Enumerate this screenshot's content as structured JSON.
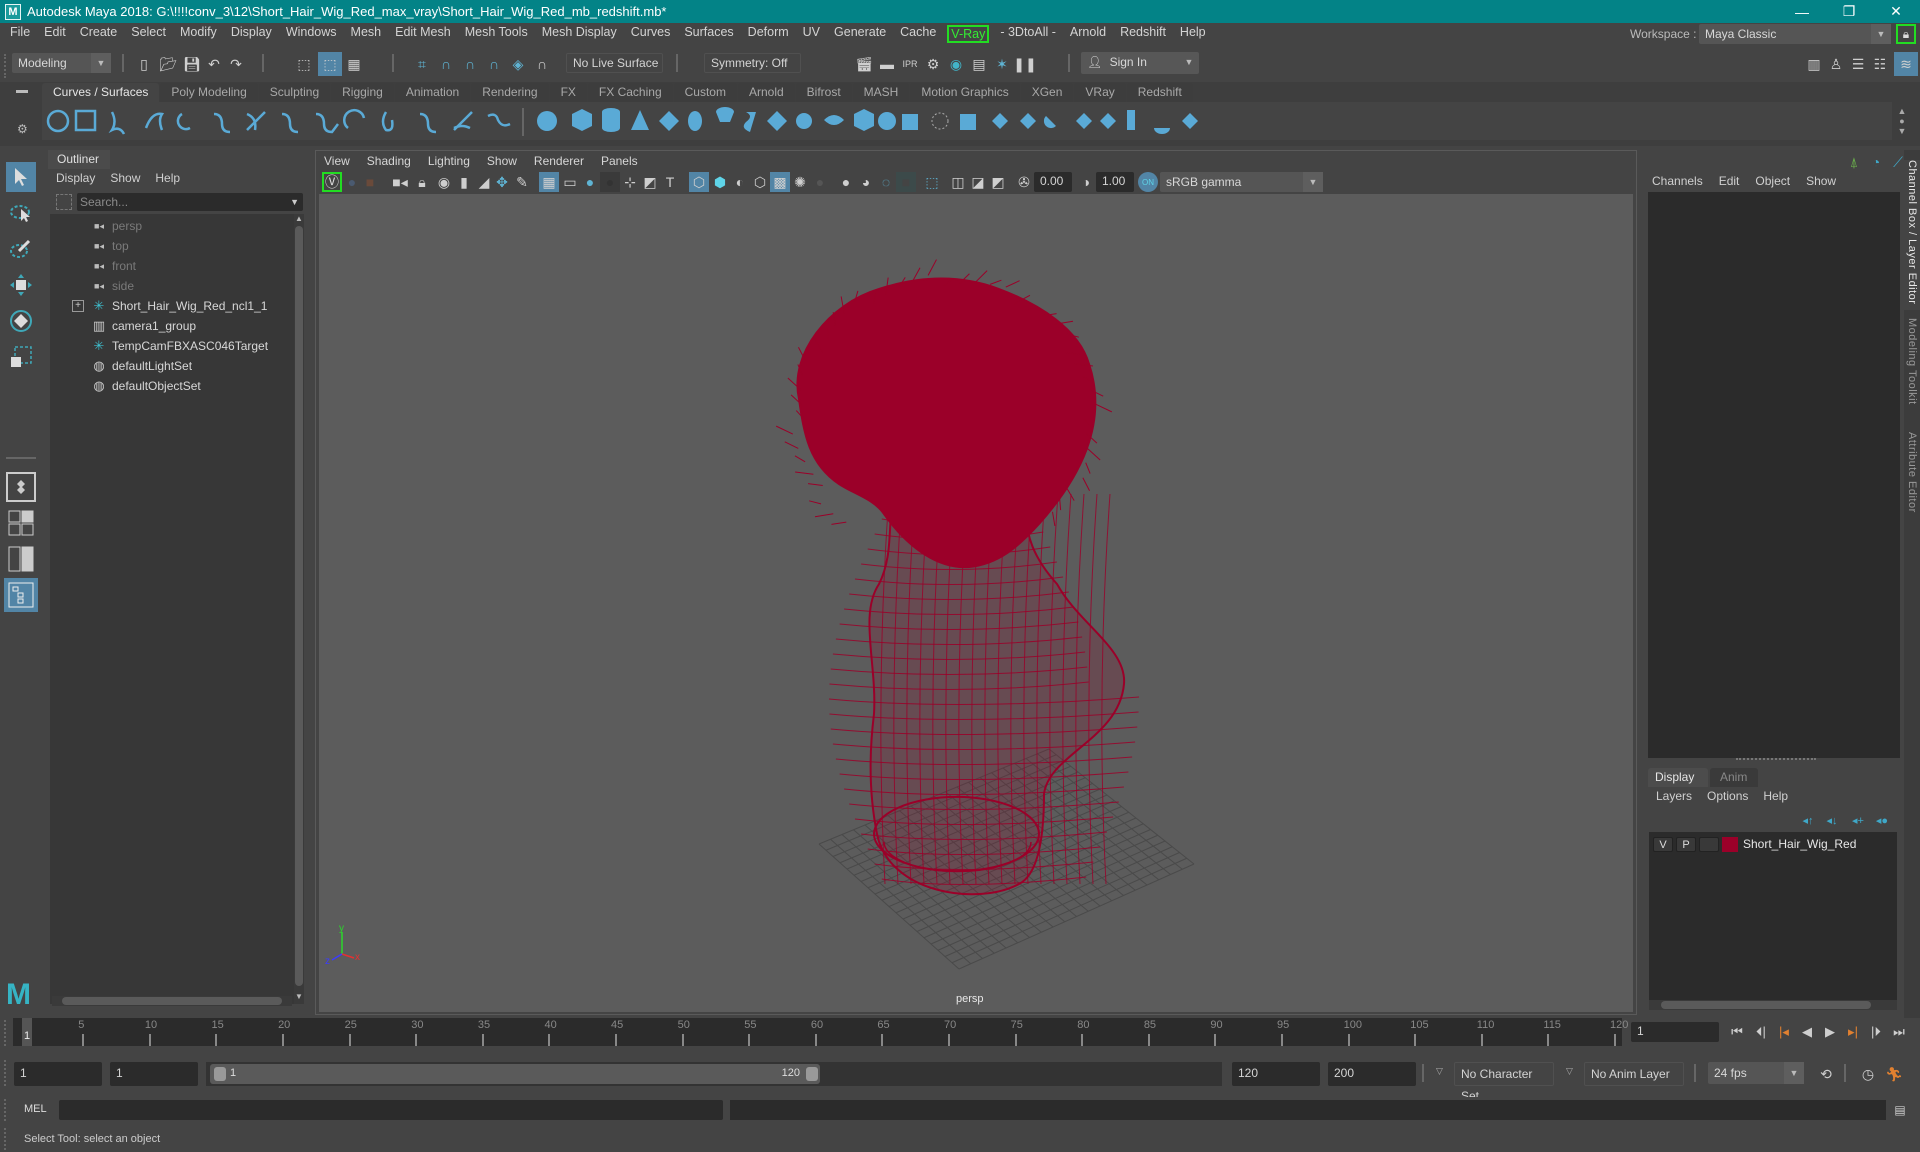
{
  "window": {
    "title": "Autodesk Maya 2018: G:\\!!!!conv_3\\12\\Short_Hair_Wig_Red_max_vray\\Short_Hair_Wig_Red_mb_redshift.mb*",
    "logo_letter": "M",
    "controls": {
      "minimize": "—",
      "maximize": "❐",
      "close": "✕"
    }
  },
  "menubar": {
    "items": [
      "File",
      "Edit",
      "Create",
      "Select",
      "Modify",
      "Display",
      "Windows",
      "Mesh",
      "Edit Mesh",
      "Mesh Tools",
      "Mesh Display",
      "Curves",
      "Surfaces",
      "Deform",
      "UV",
      "Generate",
      "Cache",
      "V-Ray",
      "- 3DtoAll -",
      "Arnold",
      "Redshift",
      "Help"
    ],
    "workspace_label": "Workspace :",
    "workspace_value": "Maya Classic"
  },
  "statusline": {
    "mode": "Modeling",
    "live_surface": "No Live Surface",
    "symmetry": "Symmetry: Off",
    "sign_in": "Sign In"
  },
  "shelf": {
    "tabs": [
      "Curves / Surfaces",
      "Poly Modeling",
      "Sculpting",
      "Rigging",
      "Animation",
      "Rendering",
      "FX",
      "FX Caching",
      "Custom",
      "Arnold",
      "Bifrost",
      "MASH",
      "Motion Graphics",
      "XGen",
      "VRay",
      "Redshift"
    ],
    "active_tab": "Curves / Surfaces"
  },
  "outliner": {
    "tab": "Outliner",
    "menu": [
      "Display",
      "Show",
      "Help"
    ],
    "search_placeholder": "Search...",
    "items": [
      {
        "name": "persp",
        "icon": "camera-icon",
        "dim": true,
        "expandable": false
      },
      {
        "name": "top",
        "icon": "camera-icon",
        "dim": true,
        "expandable": false
      },
      {
        "name": "front",
        "icon": "camera-icon",
        "dim": true,
        "expandable": false
      },
      {
        "name": "side",
        "icon": "camera-icon",
        "dim": true,
        "expandable": false
      },
      {
        "name": "Short_Hair_Wig_Red_ncl1_1",
        "icon": "locator-icon",
        "dim": false,
        "expandable": true
      },
      {
        "name": "camera1_group",
        "icon": "group-icon",
        "dim": false,
        "expandable": false
      },
      {
        "name": "TempCamFBXASC046Target",
        "icon": "locator-icon",
        "dim": false,
        "expandable": false
      },
      {
        "name": "defaultLightSet",
        "icon": "set-icon",
        "dim": false,
        "expandable": false
      },
      {
        "name": "defaultObjectSet",
        "icon": "set-icon",
        "dim": false,
        "expandable": false
      }
    ]
  },
  "viewport": {
    "menu": [
      "View",
      "Shading",
      "Lighting",
      "Show",
      "Renderer",
      "Panels"
    ],
    "exposure": "0.00",
    "gamma": "1.00",
    "color_space": "sRGB gamma",
    "camera_label": "persp",
    "wire_color": "#9b0029",
    "axis": {
      "x": "x",
      "y": "y",
      "z": "z"
    }
  },
  "channelbox": {
    "menu": [
      "Channels",
      "Edit",
      "Object",
      "Show"
    ],
    "side_tabs": [
      "Channel Box / Layer Editor",
      "Modeling Toolkit",
      "Attribute Editor"
    ]
  },
  "layer_editor": {
    "tabs": [
      "Display",
      "Anim"
    ],
    "active_tab": "Display",
    "menu": [
      "Layers",
      "Options",
      "Help"
    ],
    "layers": [
      {
        "visible": "V",
        "playback": "P",
        "name": "Short_Hair_Wig_Red",
        "color": "#9b0029"
      }
    ]
  },
  "timeline": {
    "ticks": [
      5,
      10,
      15,
      20,
      25,
      30,
      35,
      40,
      45,
      50,
      55,
      60,
      65,
      70,
      75,
      80,
      85,
      90,
      95,
      100,
      105,
      110,
      115,
      120
    ],
    "start": 1,
    "end": 120,
    "current_frame": "1",
    "current_frame_field": "1"
  },
  "range": {
    "start_field": "1",
    "playback_start": "1",
    "slider_start": "1",
    "slider_end": "120",
    "playback_end": "120",
    "end_field": "200",
    "character_set": "No Character Set",
    "anim_layer": "No Anim Layer",
    "fps": "24 fps"
  },
  "command_line": {
    "language": "MEL",
    "value": ""
  },
  "help_line": "Select Tool: select an object"
}
